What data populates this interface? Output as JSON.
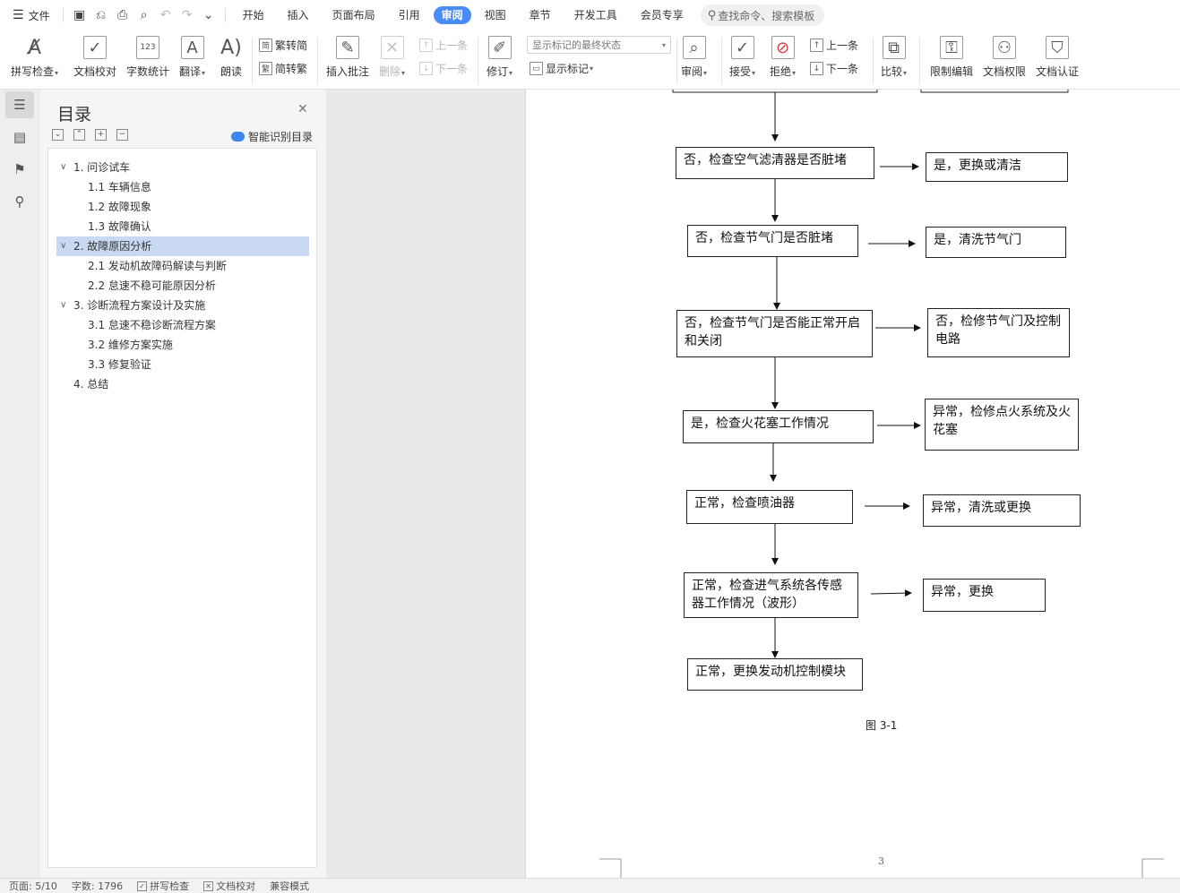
{
  "menubar": {
    "file_label": "文件",
    "tabs": [
      "开始",
      "插入",
      "页面布局",
      "引用",
      "审阅",
      "视图",
      "章节",
      "开发工具",
      "会员专享"
    ],
    "active_tab": "审阅",
    "search_placeholder": "查找命令、搜索模板"
  },
  "ribbon": {
    "spell_check": "拼写检查",
    "doc_proof": "文档校对",
    "word_count": "字数统计",
    "translate": "翻译",
    "read_aloud": "朗读",
    "trad_to_simp": "繁转简",
    "simp_to_trad": "简转繁",
    "insert_comment": "插入批注",
    "delete": "删除",
    "prev_comment": "上一条",
    "next_comment": "下一条",
    "track_changes": "修订",
    "markup_select": "显示标记的最终状态",
    "show_markup": "显示标记",
    "review": "审阅",
    "accept": "接受",
    "reject": "拒绝",
    "prev_change": "上一条",
    "next_change": "下一条",
    "compare": "比较",
    "restrict_edit": "限制编辑",
    "doc_permission": "文档权限",
    "doc_certify": "文档认证"
  },
  "nav": {
    "title": "目录",
    "smart_toc": "智能识别目录",
    "items": [
      {
        "label": "1.  问诊试车",
        "level": 1,
        "expanded": true
      },
      {
        "label": "1.1  车辆信息",
        "level": 2
      },
      {
        "label": "1.2  故障现象",
        "level": 2
      },
      {
        "label": "1.3  故障确认",
        "level": 2
      },
      {
        "label": "2.  故障原因分析",
        "level": 1,
        "expanded": true,
        "selected": true
      },
      {
        "label": "2.1 发动机故障码解读与判断",
        "level": 2
      },
      {
        "label": "2.2  怠速不稳可能原因分析",
        "level": 2
      },
      {
        "label": "3.  诊断流程方案设计及实施",
        "level": 1,
        "expanded": true
      },
      {
        "label": "3.1  怠速不稳诊断流程方案",
        "level": 2
      },
      {
        "label": "3.2  维修方案实施",
        "level": 2
      },
      {
        "label": "3.3  修复验证",
        "level": 2
      },
      {
        "label": "4.  总结",
        "level": 1
      }
    ]
  },
  "document": {
    "flow_left": [
      "否，检查空气滤清器是否脏堵",
      "否，检查节气门是否脏堵",
      "否，检查节气门是否能正常开启和关闭",
      "是，检查火花塞工作情况",
      "正常，检查喷油器",
      "正常，检查进气系统各传感器工作情况（波形）",
      "正常，更换发动机控制模块"
    ],
    "flow_right": [
      "是，更换或清洁",
      "是，清洗节气门",
      "否，检修节气门及控制电路",
      "异常，检修点火系统及火花塞",
      "异常，清洗或更换",
      "异常，更换"
    ],
    "figure_caption": "图 3-1",
    "page_number": "3"
  },
  "status": {
    "page": "页面: 5/10",
    "word_count": "字数: 1796",
    "spell_check": "拼写检查",
    "doc_proof": "文档校对",
    "compat_mode": "兼容模式"
  }
}
